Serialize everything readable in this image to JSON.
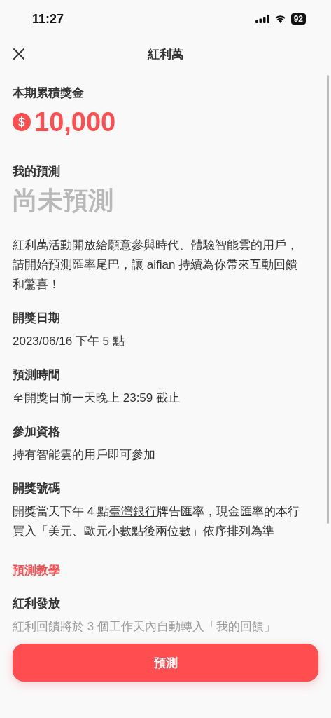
{
  "status_bar": {
    "time": "11:27",
    "battery": "92"
  },
  "header": {
    "title": "紅利萬"
  },
  "prize": {
    "label": "本期累積獎金",
    "amount": "10,000"
  },
  "prediction": {
    "label": "我的預測",
    "value": "尚未預測"
  },
  "intro": "紅利萬活動開放給願意參與時代、體驗智能雲的用戶，請開始預測匯率尾巴，讓 aifian 持續為你帶來互動回饋和驚喜！",
  "sections": [
    {
      "kind": "info",
      "title": "開獎日期",
      "body": [
        {
          "kind": "text",
          "text": "2023/06/16 下午 5 點"
        }
      ]
    },
    {
      "kind": "info",
      "title": "預測時間",
      "body": [
        {
          "kind": "text",
          "text": "至開獎日前一天晚上 23:59 截止"
        }
      ]
    },
    {
      "kind": "info",
      "title": "參加資格",
      "body": [
        {
          "kind": "text",
          "text": "持有智能雲的用戶即可參加"
        }
      ]
    },
    {
      "kind": "info",
      "title": "開獎號碼",
      "body": [
        {
          "kind": "text",
          "text": "開獎當天下午 4 點"
        },
        {
          "kind": "link",
          "text": "臺灣銀行"
        },
        {
          "kind": "text",
          "text": "牌告匯率，現金匯率的本行買入「美元、歐元小數點後兩位數」依序排列為準"
        }
      ]
    },
    {
      "kind": "link",
      "title": "預測教學"
    },
    {
      "kind": "faded",
      "title": "紅利發放",
      "body": [
        {
          "kind": "text",
          "text": "紅利回饋將於 3 個工作天內自動轉入「我的回饋」"
        }
      ]
    }
  ],
  "button": {
    "label": "預測"
  }
}
